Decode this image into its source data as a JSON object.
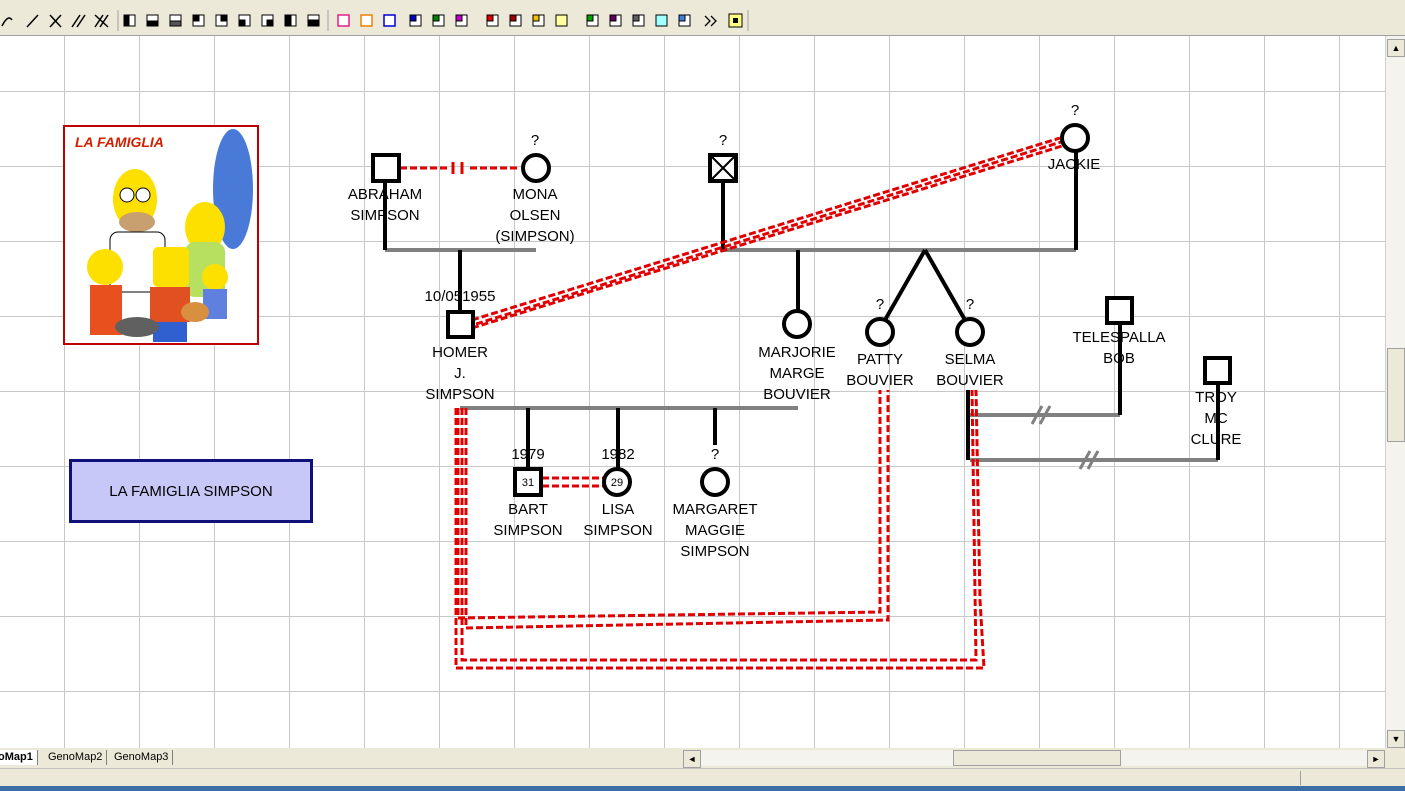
{
  "colors": {
    "relation": "#e00000",
    "line": "#000000",
    "grey_line": "#808080",
    "box_fill": "#c8c8f8",
    "box_border": "#10107a"
  },
  "toolbar": {
    "icons": [
      "pen-icon",
      "slash-line-icon",
      "cross-line-icon",
      "double-slash-icon",
      "double-cross-icon",
      "left-half-icon",
      "bottom-half-icon",
      "grey-half-icon",
      "quarter-icon",
      "quarter-b-icon",
      "quarter-c-icon",
      "quarter-d-icon",
      "quarter-e-icon",
      "quarter-f-icon",
      "pink-square-icon",
      "orange-square-icon",
      "blue-square-icon",
      "blue-corner-icon",
      "green-corner-icon",
      "magenta-corner-icon",
      "red-corner-icon",
      "darkred-corner-icon",
      "yellow-corner-icon",
      "yellow-square-icon",
      "green-sq-icon",
      "purple-sq-icon",
      "grey-sq-icon",
      "cyan-sq-icon",
      "lightblue-sq-icon",
      "more-icon",
      "yellow-box-icon"
    ]
  },
  "title_box": {
    "label": "LA FAMIGLIA SIMPSON"
  },
  "picture": {
    "caption": "LA FAMIGLIA"
  },
  "people": {
    "abraham": {
      "line1": "ABRAHAM",
      "line2": "SIMPSON"
    },
    "mona": {
      "top": "?",
      "line1": "MONA",
      "line2": "OLSEN",
      "line3": "(SIMPSON)"
    },
    "unknown_father": {
      "top": "?"
    },
    "jackie": {
      "top": "?",
      "line1": "JACKIE"
    },
    "homer": {
      "top": "10/051955",
      "line1": "HOMER",
      "line2": "J.",
      "line3": "SIMPSON"
    },
    "marjorie": {
      "line1": "MARJORIE",
      "line2": "MARGE",
      "line3": "BOUVIER"
    },
    "patty": {
      "top": "?",
      "line1": "PATTY",
      "line2": "BOUVIER"
    },
    "selma": {
      "top": "?",
      "line1": "SELMA",
      "line2": "BOUVIER"
    },
    "telespalla": {
      "line1": "TELESPALLA",
      "line2": "BOB"
    },
    "troy": {
      "line1": "TROY",
      "line2": "MC",
      "line3": "CLURE"
    },
    "bart": {
      "top": "1979",
      "age": "31",
      "line1": "BART",
      "line2": "SIMPSON"
    },
    "lisa": {
      "top": "1982",
      "age": "29",
      "line1": "LISA",
      "line2": "SIMPSON"
    },
    "maggie": {
      "top": "?",
      "line1": "MARGARET",
      "line2": "MAGGIE",
      "line3": "SIMPSON"
    }
  },
  "tabs": [
    {
      "label": "oMap1"
    },
    {
      "label": "GenoMap2"
    },
    {
      "label": "GenoMap3"
    }
  ],
  "scroll": {
    "up": "▲",
    "down": "▼",
    "left": "◄",
    "right": "►"
  }
}
